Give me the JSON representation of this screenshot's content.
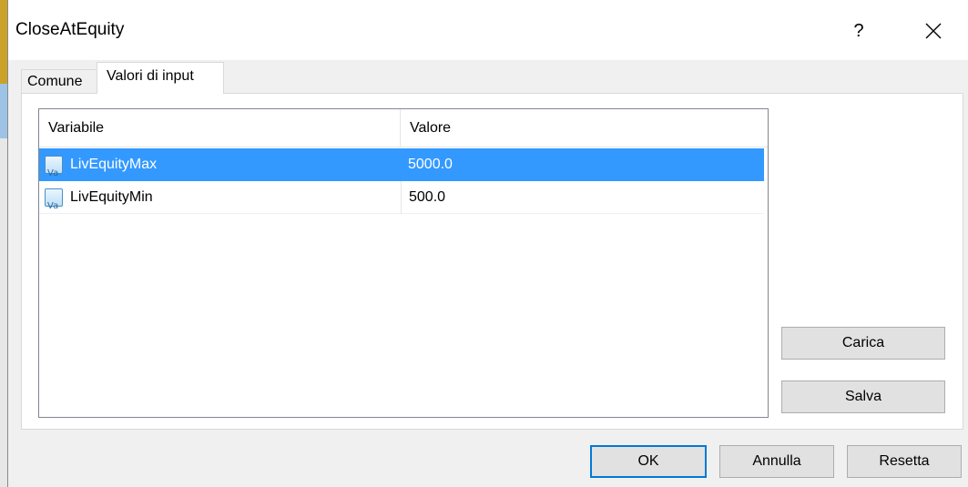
{
  "window": {
    "title": "CloseAtEquity",
    "help_label": "?",
    "close_icon": "close-icon"
  },
  "tabs": [
    {
      "label": "Comune",
      "active": false
    },
    {
      "label": "Valori di input",
      "active": true
    }
  ],
  "table": {
    "columns": [
      "Variabile",
      "Valore"
    ],
    "rows": [
      {
        "name": "LivEquityMax",
        "value": "5000.0",
        "selected": true,
        "icon": "variable-icon"
      },
      {
        "name": "LivEquityMin",
        "value": "500.0",
        "selected": false,
        "icon": "variable-icon"
      }
    ]
  },
  "side_buttons": {
    "load_label": "Carica",
    "save_label": "Salva"
  },
  "footer_buttons": {
    "ok_label": "OK",
    "cancel_label": "Annulla",
    "reset_label": "Resetta"
  },
  "colors": {
    "selection": "#3399ff",
    "default_button_border": "#0078d7"
  }
}
